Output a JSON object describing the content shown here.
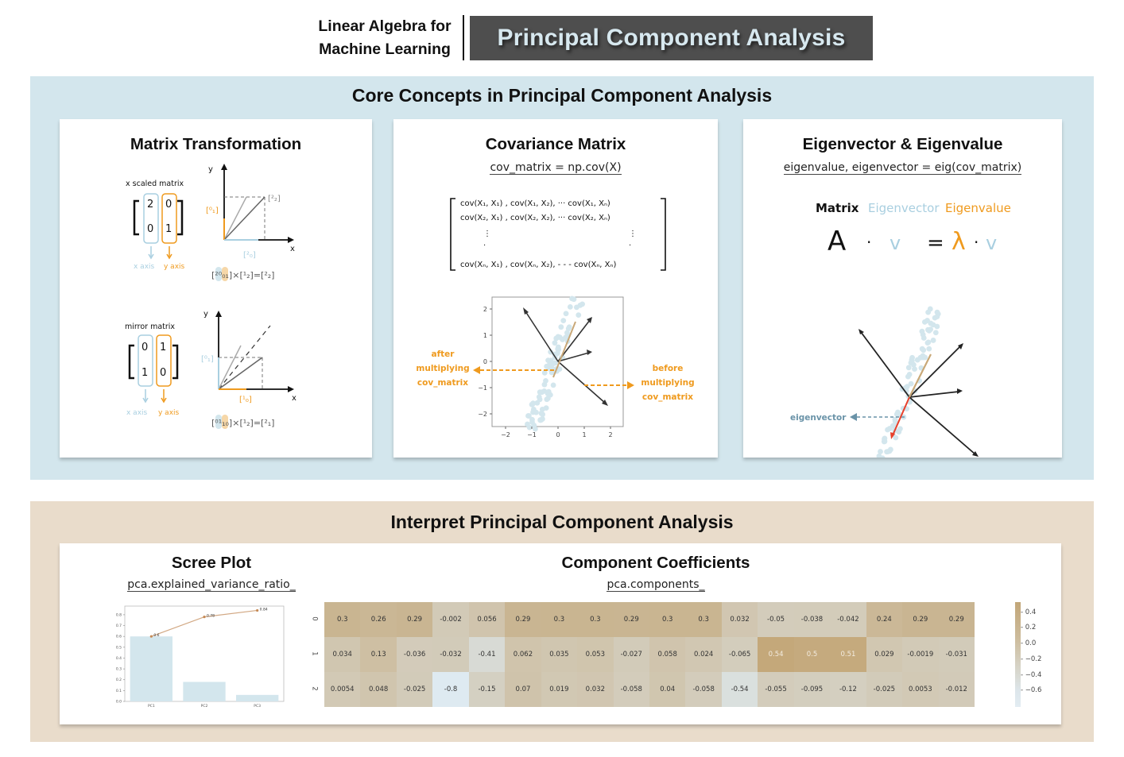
{
  "header": {
    "subtitle_line1": "Linear Algebra for",
    "subtitle_line2": "Machine Learning",
    "title": "Principal Component Analysis"
  },
  "core_section": {
    "title": "Core Concepts in Principal Component Analysis",
    "cards": [
      {
        "title": "Matrix Transformation",
        "examples": [
          {
            "label": "x scaled matrix",
            "matrix": [
              [
                "2",
                "0"
              ],
              [
                "0",
                "1"
              ]
            ],
            "column_labels": [
              "x axis",
              "y axis"
            ],
            "vector_labels": [
              "[0;1]",
              "[2;0]",
              "[2;2]"
            ],
            "equation": "[2 0; 0 1] × [1; 2] = [2; 2]"
          },
          {
            "label": "mirror matrix",
            "matrix": [
              [
                "0",
                "1"
              ],
              [
                "1",
                "0"
              ]
            ],
            "column_labels": [
              "x axis",
              "y axis"
            ],
            "vector_labels": [
              "[0;1]",
              "[1;0]"
            ],
            "equation": "[0 1; 1 0] × [1; 2] = [2; 1]"
          }
        ],
        "axis_labels": {
          "x": "x",
          "y": "y"
        }
      },
      {
        "title": "Covariance Matrix",
        "code": "cov_matrix = np.cov(X)",
        "matrix_rows": [
          "cov(X₁, X₁) ,  cov(X₁, X₂), ···  cov(X₁, Xₙ)",
          "cov(X₂, X₁) ,  cov(X₂, X₂), ···  cov(X₂, Xₙ)",
          "⋮                                          ⋮",
          "cov(Xₙ, X₁) ,  cov(Xₙ, X₂), - - - cov(Xₙ, Xₙ)"
        ],
        "plot_ticks_x": [
          "−2",
          "−1",
          "0",
          "1",
          "2"
        ],
        "plot_ticks_y": [
          "2",
          "1",
          "0",
          "−1",
          "−2"
        ],
        "annotation_left": [
          "after",
          "multiplying",
          "cov_matrix"
        ],
        "annotation_right": [
          "before",
          "multiplying",
          "cov_matrix"
        ]
      },
      {
        "title": "Eigenvector & Eigenvalue",
        "code": "eigenvalue, eigenvector = eig(cov_matrix)",
        "legend": {
          "matrix": "Matrix",
          "eigenvector": "Eigenvector",
          "eigenvalue": "Eigenvalue"
        },
        "equation": {
          "A": "A",
          "dot": "·",
          "v": "v",
          "eq": "=",
          "lambda": "λ"
        },
        "annotation": "eigenvector"
      }
    ]
  },
  "interpret_section": {
    "title": "Interpret Principal Component Analysis",
    "scree": {
      "title": "Scree Plot",
      "code": "pca.explained_variance_ratio_"
    },
    "coefficients": {
      "title": "Component Coefficients",
      "code": "pca.components_"
    }
  },
  "colors": {
    "core_bg": "#d3e6ed",
    "interp_bg": "#e9dccb",
    "header_box": "#4e4e4e",
    "header_text": "#d7e8ef",
    "orange": "#ef9a1e",
    "light_blue": "#a9cfe0",
    "eigen_red": "#e8412c",
    "tan": "#c9a878"
  },
  "chart_data": [
    {
      "type": "bar",
      "title": "Scree Plot",
      "categories": [
        "PC1",
        "PC2",
        "PC3"
      ],
      "values": [
        0.6,
        0.18,
        0.06
      ],
      "cumulative_line": [
        0.6,
        0.78,
        0.84
      ],
      "cumulative_labels": [
        "0.6",
        "0.78",
        "0.84"
      ],
      "ylim": [
        0,
        0.88
      ],
      "yticks": [
        "0.0",
        "0.1",
        "0.2",
        "0.3",
        "0.4",
        "0.5",
        "0.6",
        "0.7",
        "0.8"
      ],
      "xlabel": "",
      "ylabel": ""
    },
    {
      "type": "heatmap",
      "title": "Component Coefficients",
      "row_labels": [
        "0",
        "1",
        "2"
      ],
      "values": [
        [
          0.3,
          0.26,
          0.29,
          -0.002,
          0.056,
          0.29,
          0.3,
          0.3,
          0.29,
          0.3,
          0.3,
          0.032,
          -0.05,
          -0.038,
          -0.042,
          0.24,
          0.29,
          0.29
        ],
        [
          0.034,
          0.13,
          -0.036,
          -0.032,
          -0.41,
          0.062,
          0.035,
          0.053,
          -0.027,
          0.058,
          0.024,
          -0.065,
          0.54,
          0.5,
          0.51,
          0.029,
          -0.0019,
          -0.031
        ],
        [
          0.0054,
          0.048,
          -0.025,
          -0.8,
          -0.15,
          0.07,
          0.019,
          0.032,
          -0.058,
          0.04,
          -0.058,
          -0.54,
          -0.055,
          -0.095,
          -0.12,
          -0.025,
          0.0053,
          -0.012
        ]
      ],
      "colorbar_ticks": [
        "0.4",
        "0.2",
        "0.0",
        "−0.2",
        "−0.4",
        "−0.6"
      ],
      "colorbar_range": [
        -0.8,
        0.54
      ]
    }
  ]
}
